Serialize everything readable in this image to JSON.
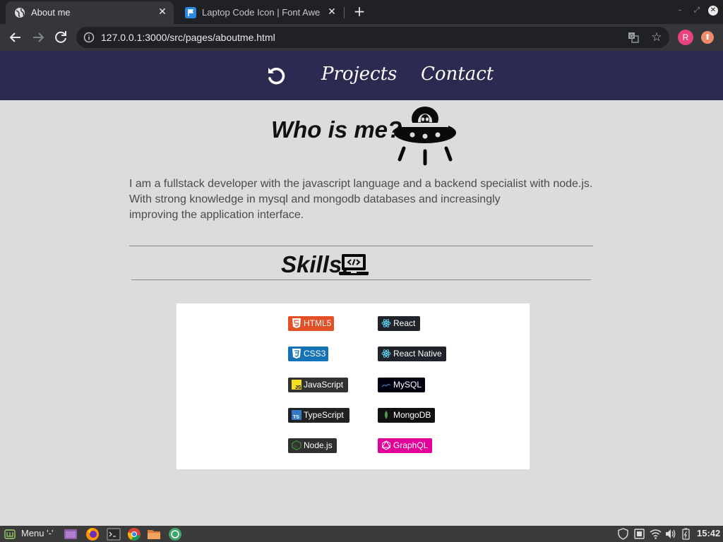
{
  "browser": {
    "tabs": [
      {
        "title": "About me",
        "active": true,
        "icon": "globe-icon"
      },
      {
        "title": "Laptop Code Icon | Font Awesome",
        "active": false,
        "icon": "flag-icon"
      }
    ],
    "url": "127.0.0.1:3000/src/pages/aboutme.html",
    "profile_initial": "R"
  },
  "page": {
    "nav": {
      "projects": "Projects",
      "contact": "Contact"
    },
    "title": "Who is me?",
    "bio": [
      "I am a fullstack developer with the javascript language and a backend specialist with node.js.",
      "With strong knowledge in mysql and mongodb databases and increasingly",
      "improving the application interface."
    ],
    "skills_title": "Skills:",
    "skills": [
      {
        "label": "HTML5",
        "color": "#e34f26",
        "icon": "html5-icon"
      },
      {
        "label": "React",
        "color": "#20232a",
        "icon": "react-icon"
      },
      {
        "label": "CSS3",
        "color": "#1572b6",
        "icon": "css3-icon"
      },
      {
        "label": "React Native",
        "color": "#20232a",
        "icon": "react-icon"
      },
      {
        "label": "JavaScript",
        "color": "#323330",
        "icon": "javascript-icon"
      },
      {
        "label": "MySQL",
        "color": "#00000f",
        "icon": "mysql-icon"
      },
      {
        "label": "TypeScript",
        "color": "#222222",
        "icon": "typescript-icon"
      },
      {
        "label": "MongoDB",
        "color": "#111111",
        "icon": "mongodb-icon"
      },
      {
        "label": "Node.js",
        "color": "#303030",
        "icon": "nodejs-icon"
      },
      {
        "label": "GraphQL",
        "color": "#e10098",
        "icon": "graphql-icon"
      }
    ]
  },
  "taskbar": {
    "menu_label": "Menu '-'",
    "clock": "15:42"
  },
  "colors": {
    "header_bg": "#2d2a52",
    "page_bg": "#dcdcdc",
    "bio_text": "#4b4b4b"
  }
}
